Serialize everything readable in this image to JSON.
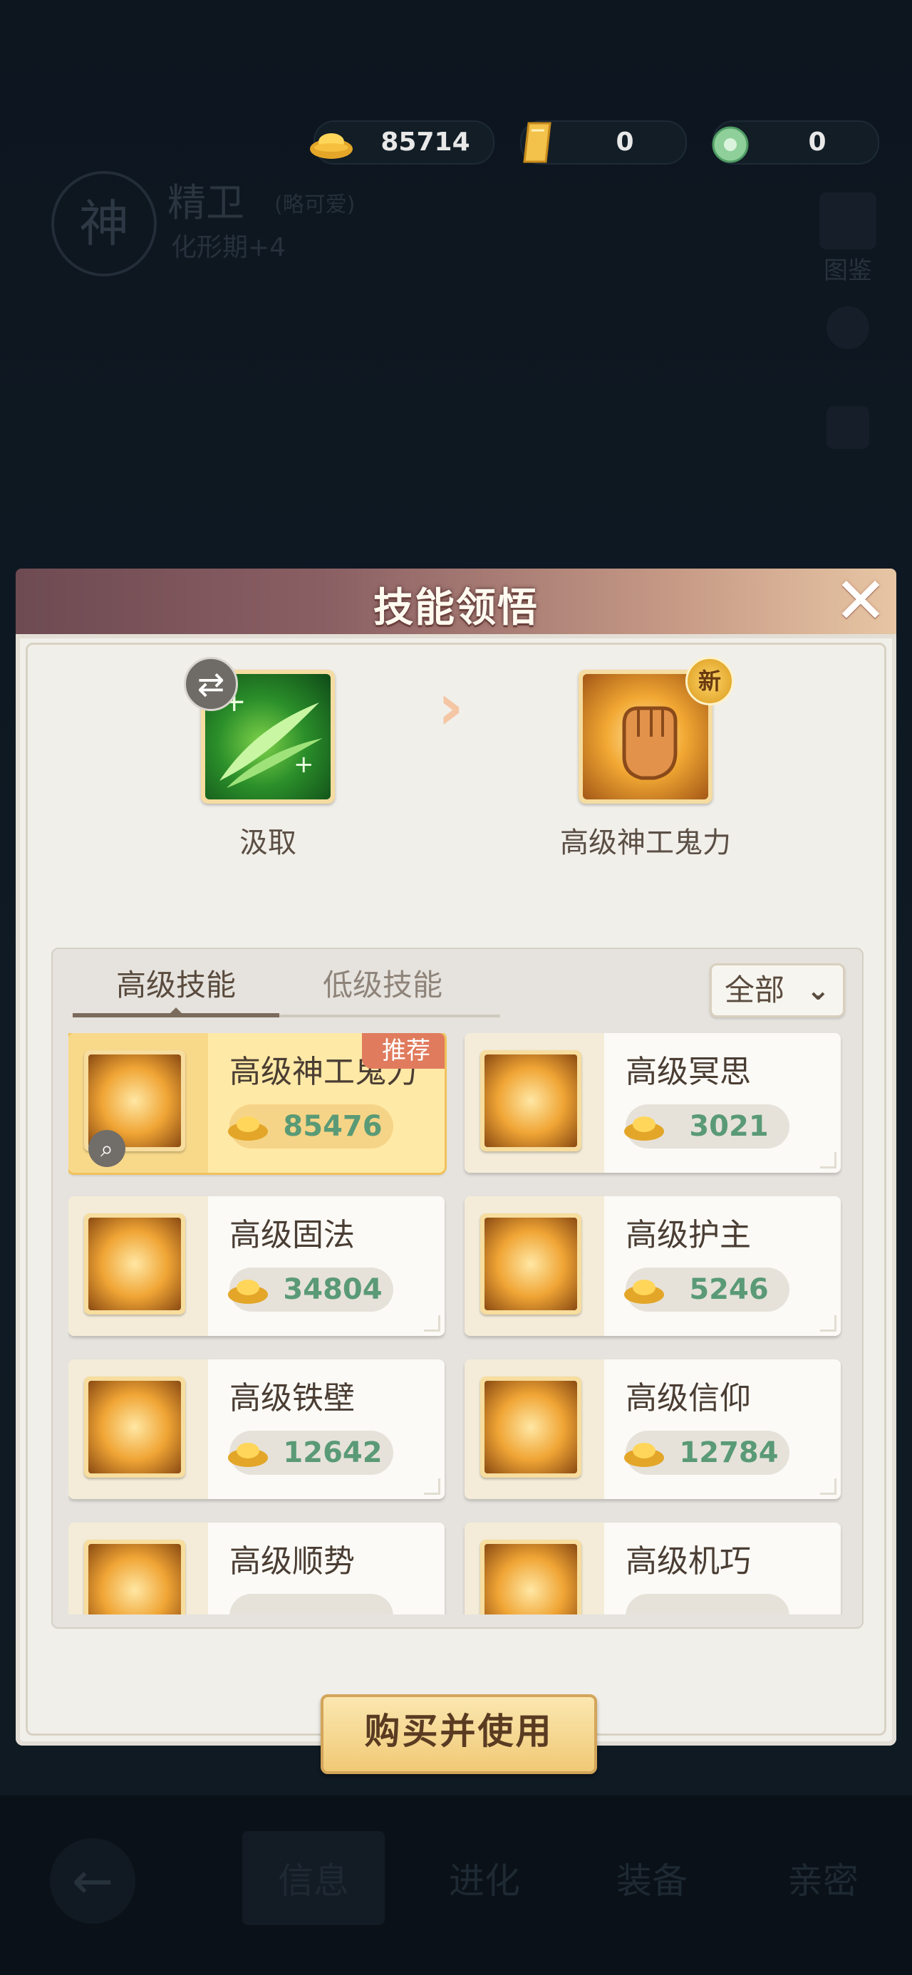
{
  "currency": [
    {
      "icon": "gold-ingot-icon",
      "value": "85714"
    },
    {
      "icon": "gold-bar-icon",
      "value": "0"
    },
    {
      "icon": "jade-icon",
      "value": "0"
    }
  ],
  "pet": {
    "avatar_glyph": "神",
    "name": "精卫",
    "tag": "(略可爱)",
    "sub": "化形期+4"
  },
  "side_buttons": [
    {
      "label": "图鉴"
    },
    {
      "label": ""
    },
    {
      "label": ""
    }
  ],
  "bottom_nav": {
    "back_glyph": "←",
    "tabs": [
      "信息",
      "进化",
      "装备",
      "亲密"
    ]
  },
  "dialog": {
    "title": "技能领悟",
    "close_glyph": "✕",
    "source_skill": "汲取",
    "target_skill": "高级神工鬼力",
    "new_badge": "新",
    "swap_glyph": "⇄",
    "arrow_glyph": "›",
    "tabs": [
      "高级技能",
      "低级技能"
    ],
    "filter": {
      "label": "全部",
      "chevron": "⌄"
    },
    "recommend_tag": "推荐",
    "zoom_glyph": "⌕",
    "skills": [
      {
        "name": "高级神工鬼力",
        "price": "85476"
      },
      {
        "name": "高级冥思",
        "price": "3021"
      },
      {
        "name": "高级固法",
        "price": "34804"
      },
      {
        "name": "高级护主",
        "price": "5246"
      },
      {
        "name": "高级铁壁",
        "price": "12642"
      },
      {
        "name": "高级信仰",
        "price": "12784"
      },
      {
        "name": "高级顺势",
        "price": ""
      },
      {
        "name": "高级机巧",
        "price": ""
      }
    ],
    "buy_button": "购买并使用"
  },
  "colors": {
    "accent_gold": "#f0c25b",
    "price_green": "#5a9a76",
    "recommend_red": "#e07b5d"
  }
}
